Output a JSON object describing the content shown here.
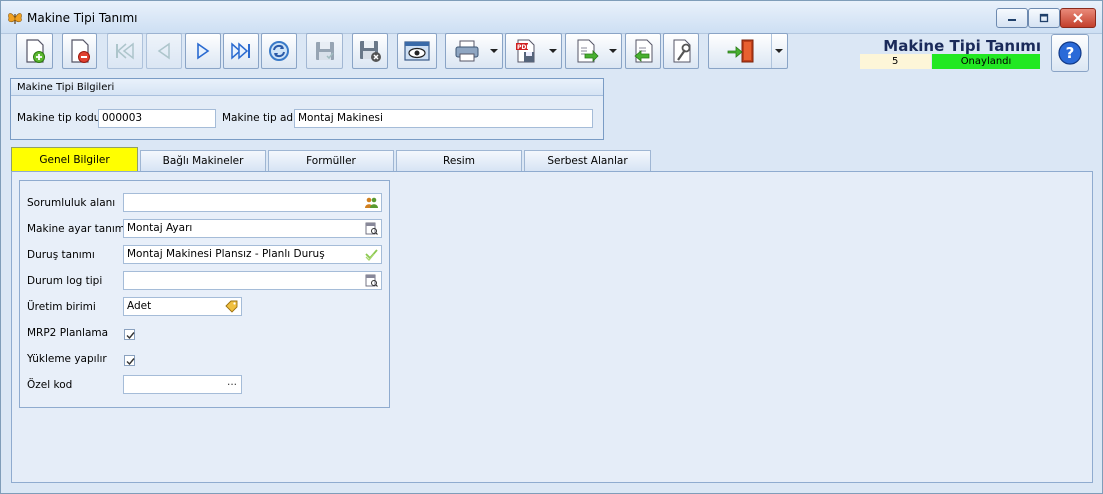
{
  "window": {
    "title": "Makine Tipi Tanımı",
    "controls": [
      "minimize",
      "maximize",
      "close"
    ]
  },
  "toolbar": {
    "buttons": [
      {
        "name": "new-record",
        "icon": "new-document-icon"
      },
      {
        "name": "delete-record",
        "icon": "delete-document-icon"
      },
      {
        "name": "first-record",
        "icon": "first-icon"
      },
      {
        "name": "previous-record",
        "icon": "previous-icon"
      },
      {
        "name": "next-record",
        "icon": "next-icon"
      },
      {
        "name": "last-record",
        "icon": "last-icon"
      },
      {
        "name": "refresh",
        "icon": "refresh-icon"
      },
      {
        "name": "save",
        "icon": "save-icon"
      },
      {
        "name": "save-close",
        "icon": "save-close-icon"
      },
      {
        "name": "preview",
        "icon": "preview-icon"
      },
      {
        "name": "print",
        "icon": "printer-icon"
      },
      {
        "name": "export-pdf",
        "icon": "pdf-icon"
      },
      {
        "name": "export",
        "icon": "export-icon"
      },
      {
        "name": "import",
        "icon": "import-icon"
      },
      {
        "name": "tools",
        "icon": "tools-icon"
      },
      {
        "name": "exit",
        "icon": "exit-door-icon"
      }
    ]
  },
  "header": {
    "title": "Makine Tipi Tanımı",
    "record_no": "5",
    "status": "Onaylandı",
    "status_color": "#22e822",
    "help_icon": "help-icon"
  },
  "info_group": {
    "title": "Makine Tipi Bilgileri",
    "code_label": "Makine tip kodu",
    "code_value": "000003",
    "name_label": "Makine tip adı",
    "name_value": "Montaj Makinesi"
  },
  "tabs": [
    {
      "label": "Genel Bilgiler",
      "active": true
    },
    {
      "label": "Bağlı Makineler",
      "active": false
    },
    {
      "label": "Formüller",
      "active": false
    },
    {
      "label": "Resim",
      "active": false
    },
    {
      "label": "Serbest Alanlar",
      "active": false
    }
  ],
  "general": {
    "responsibility_label": "Sorumluluk alanı",
    "responsibility_value": "",
    "setting_label": "Makine ayar tanımı",
    "setting_value": "Montaj Ayarı",
    "stop_label": "Duruş tanımı",
    "stop_value": "Montaj Makinesi Plansız - Planlı Duruş",
    "log_label": "Durum log tipi",
    "log_value": "",
    "unit_label": "Üretim birimi",
    "unit_value": "Adet",
    "mrp_label": "MRP2 Planlama",
    "mrp_checked": true,
    "load_label": "Yükleme yapılır",
    "load_checked": true,
    "special_label": "Özel kod",
    "special_value": "",
    "special_button": "..."
  }
}
